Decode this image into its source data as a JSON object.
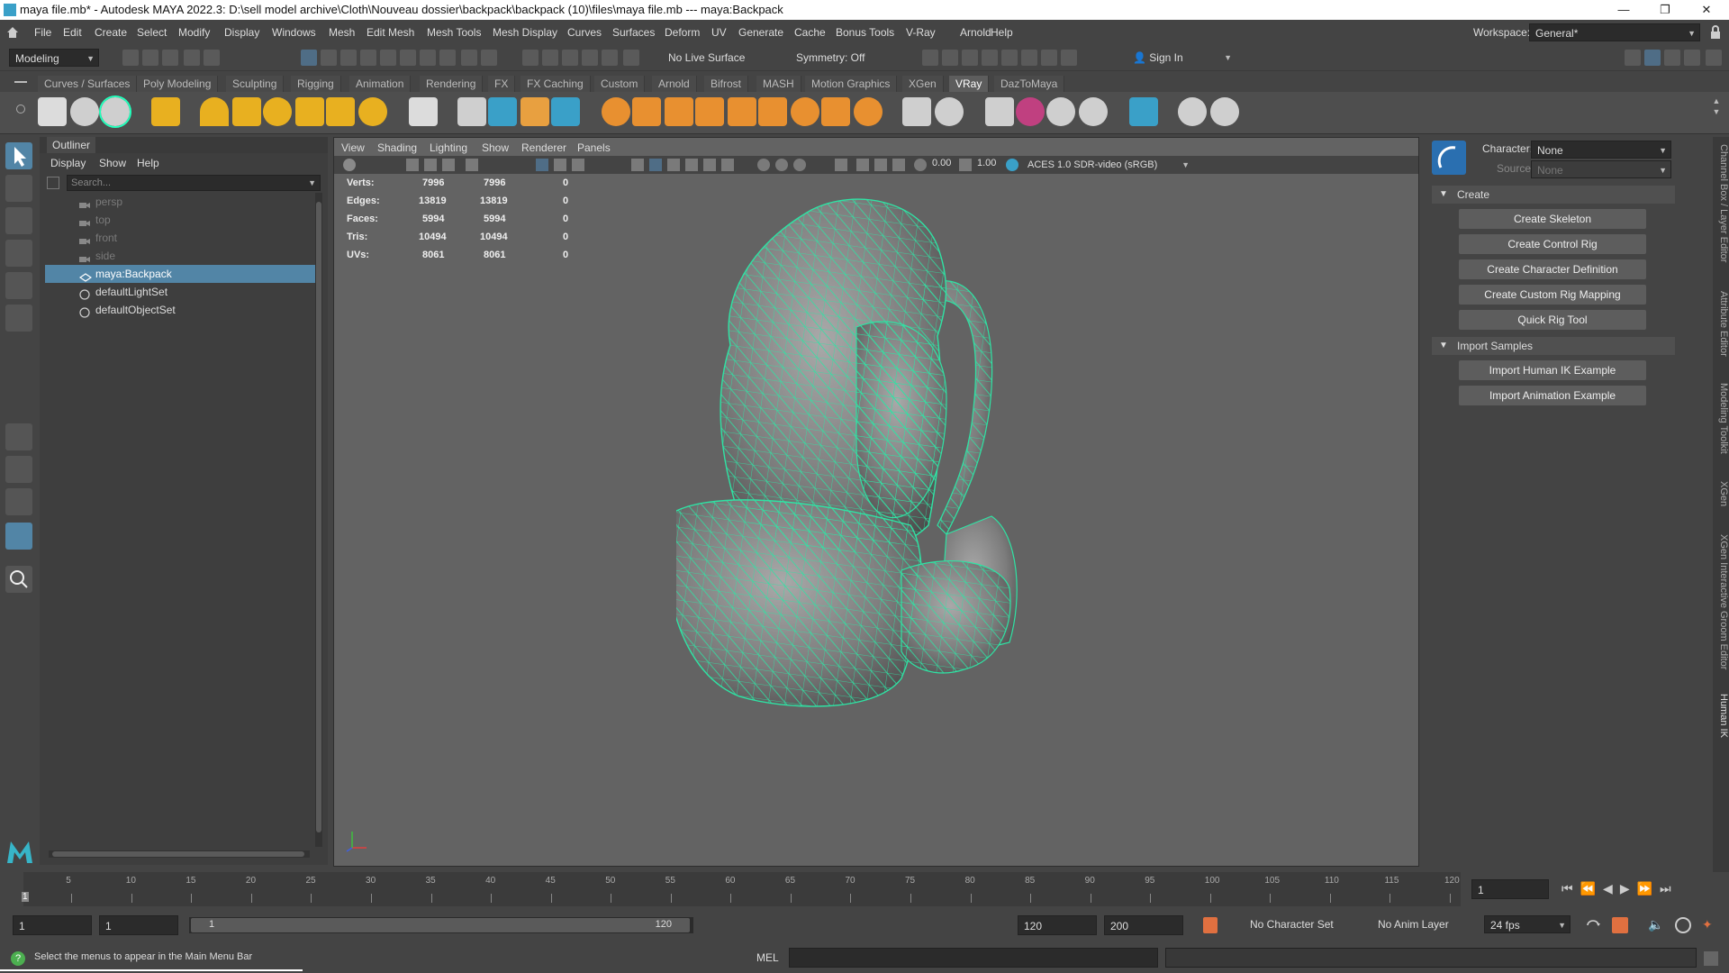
{
  "window": {
    "title": "maya file.mb* - Autodesk MAYA 2022.3: D:\\sell model archive\\Cloth\\Nouveau dossier\\backpack\\backpack (10)\\files\\maya file.mb  ---  maya:Backpack",
    "minimize": "—",
    "maximize": "❐",
    "close": "✕"
  },
  "menubar": {
    "items": [
      "File",
      "Edit",
      "Create",
      "Select",
      "Modify",
      "Display",
      "Windows",
      "Mesh",
      "Edit Mesh",
      "Mesh Tools",
      "Mesh Display",
      "Curves",
      "Surfaces",
      "Deform",
      "UV",
      "Generate",
      "Cache",
      "Bonus Tools",
      "V-Ray",
      "Arnold",
      "Help"
    ],
    "workspace_label": "Workspace:",
    "workspace_value": "General*"
  },
  "statusline": {
    "mode": "Modeling",
    "live_surface": "No Live Surface",
    "symmetry": "Symmetry: Off",
    "sign_in": "Sign In"
  },
  "shelf": {
    "tabs": [
      "Curves / Surfaces",
      "Poly Modeling",
      "Sculpting",
      "Rigging",
      "Animation",
      "Rendering",
      "FX",
      "FX Caching",
      "Custom",
      "Arnold",
      "Bifrost",
      "MASH",
      "Motion Graphics",
      "XGen",
      "VRay",
      "DazToMaya"
    ],
    "active_tab": "VRay"
  },
  "outliner": {
    "title": "Outliner",
    "menus": [
      "Display",
      "Show",
      "Help"
    ],
    "search_placeholder": "Search...",
    "items": [
      {
        "label": "persp",
        "icon": "camera-icon",
        "dim": true,
        "selected": false
      },
      {
        "label": "top",
        "icon": "camera-icon",
        "dim": true,
        "selected": false
      },
      {
        "label": "front",
        "icon": "camera-icon",
        "dim": true,
        "selected": false
      },
      {
        "label": "side",
        "icon": "camera-icon",
        "dim": true,
        "selected": false
      },
      {
        "label": "maya:Backpack",
        "icon": "reference-node-icon",
        "dim": false,
        "selected": true
      },
      {
        "label": "defaultLightSet",
        "icon": "set-icon",
        "dim": false,
        "selected": false
      },
      {
        "label": "defaultObjectSet",
        "icon": "set-icon",
        "dim": false,
        "selected": false
      }
    ]
  },
  "viewport": {
    "menus": [
      "View",
      "Shading",
      "Lighting",
      "Show",
      "Renderer",
      "Panels"
    ],
    "near_value": "0.00",
    "far_value": "1.00",
    "color_space": "ACES 1.0 SDR-video (sRGB)",
    "hud": [
      {
        "label": "Verts:",
        "a": "7996",
        "b": "7996",
        "c": "0"
      },
      {
        "label": "Edges:",
        "a": "13819",
        "b": "13819",
        "c": "0"
      },
      {
        "label": "Faces:",
        "a": "5994",
        "b": "5994",
        "c": "0"
      },
      {
        "label": "Tris:",
        "a": "10494",
        "b": "10494",
        "c": "0"
      },
      {
        "label": "UVs:",
        "a": "8061",
        "b": "8061",
        "c": "0"
      }
    ]
  },
  "humanik": {
    "character_label": "Character:",
    "character_value": "None",
    "source_label": "Source:",
    "source_value": "None",
    "create_section": "Create",
    "create_buttons": [
      "Create Skeleton",
      "Create Control Rig",
      "Create Character Definition",
      "Create Custom Rig Mapping",
      "Quick Rig Tool"
    ],
    "import_section": "Import Samples",
    "import_buttons": [
      "Import Human IK Example",
      "Import Animation Example"
    ]
  },
  "side_tabs": [
    "Channel Box / Layer Editor",
    "Attribute Editor",
    "Modeling Toolkit",
    "XGen",
    "XGen Interactive Groom Editor",
    "Human IK"
  ],
  "timeline": {
    "ticks": [
      "5",
      "10",
      "15",
      "20",
      "25",
      "30",
      "35",
      "40",
      "45",
      "50",
      "55",
      "60",
      "65",
      "70",
      "75",
      "80",
      "85",
      "90",
      "95",
      "100",
      "105",
      "110",
      "115",
      "120"
    ],
    "current_frame_marker": "1",
    "current_frame_field": "1"
  },
  "range": {
    "start": "1",
    "playback_start": "1",
    "slider_start": "1",
    "slider_end": "120",
    "playback_end": "120",
    "end": "200",
    "character_set": "No Character Set",
    "anim_layer": "No Anim Layer",
    "fps": "24 fps"
  },
  "cmdline": {
    "help_text": "Select the menus to appear in the Main Menu Bar",
    "lang": "MEL"
  },
  "colors": {
    "wireframe": "#2fe3a4",
    "selection": "#5285a6",
    "accent": "#3aa0c8"
  }
}
